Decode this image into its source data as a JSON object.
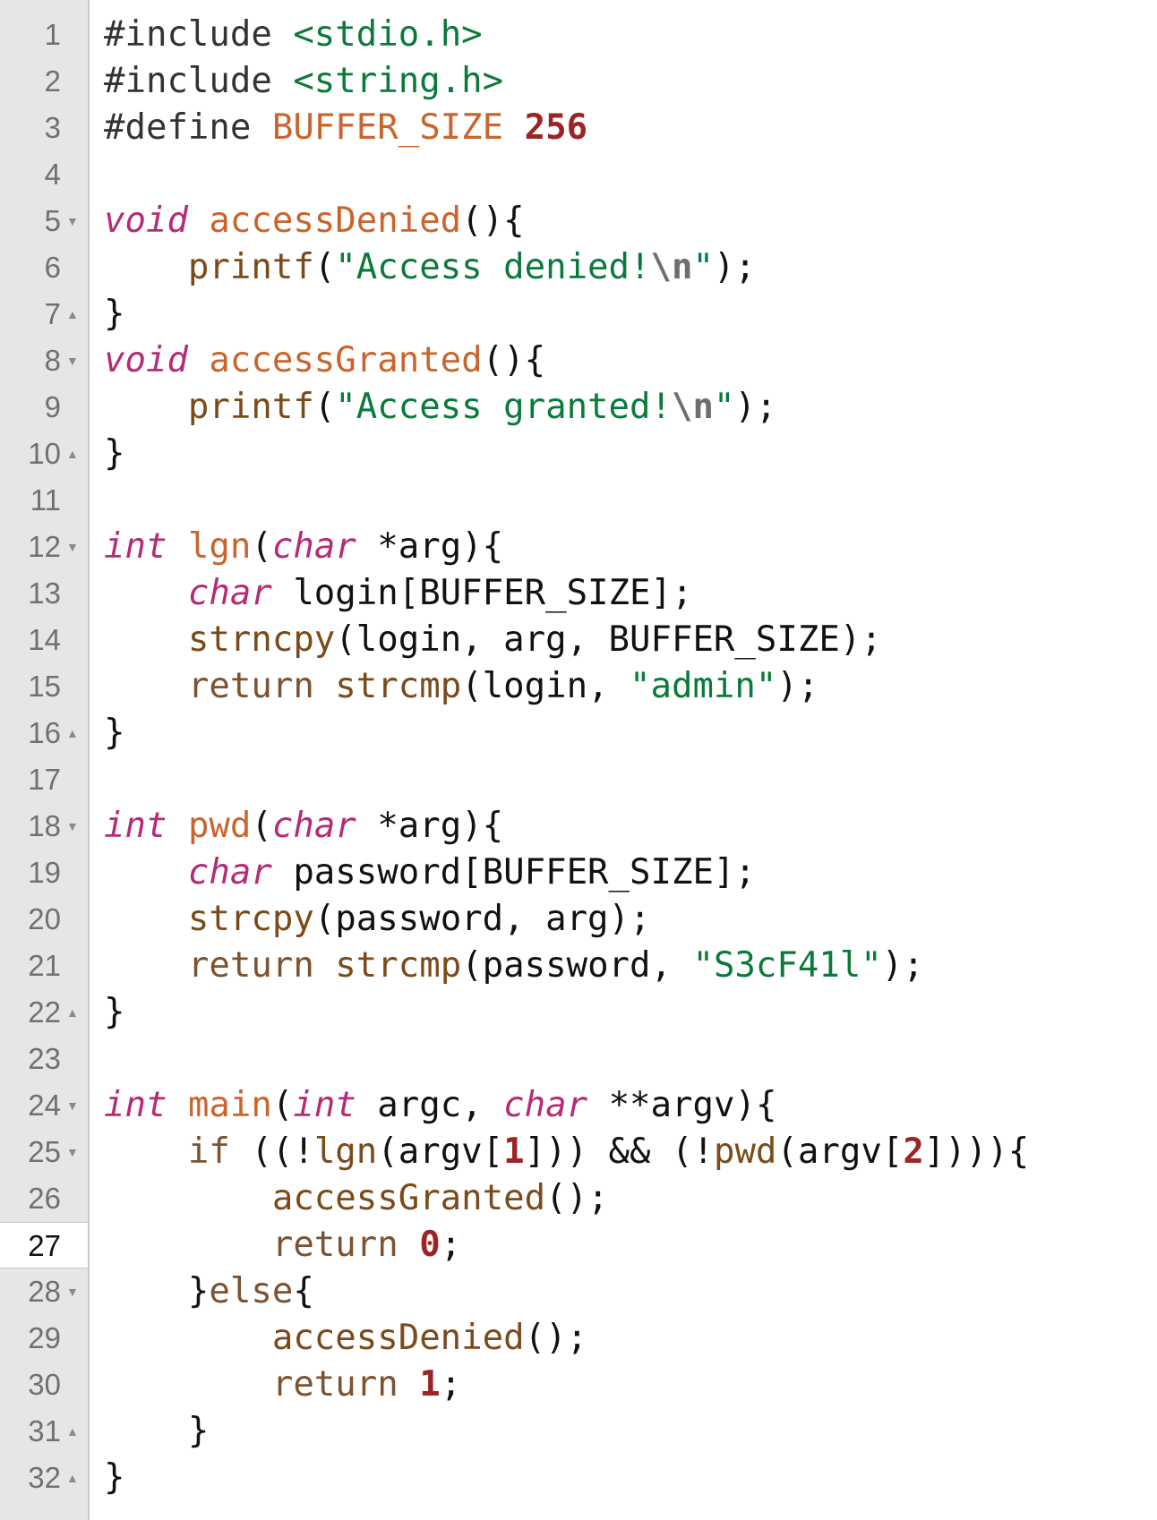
{
  "editor": {
    "active_line": 27,
    "lines": [
      {
        "n": "1",
        "fold": "",
        "tokens": [
          {
            "c": "t-pp",
            "t": "#include "
          },
          {
            "c": "t-str",
            "t": "<stdio.h>"
          }
        ]
      },
      {
        "n": "2",
        "fold": "",
        "tokens": [
          {
            "c": "t-pp",
            "t": "#include "
          },
          {
            "c": "t-str",
            "t": "<string.h>"
          }
        ]
      },
      {
        "n": "3",
        "fold": "",
        "tokens": [
          {
            "c": "t-pp",
            "t": "#define "
          },
          {
            "c": "t-mac",
            "t": "BUFFER_SIZE"
          },
          {
            "c": "t-plain",
            "t": " "
          },
          {
            "c": "t-num",
            "t": "256"
          }
        ]
      },
      {
        "n": "4",
        "fold": "",
        "tokens": []
      },
      {
        "n": "5",
        "fold": "▼",
        "tokens": [
          {
            "c": "t-kw",
            "t": "void"
          },
          {
            "c": "t-plain",
            "t": " "
          },
          {
            "c": "t-func",
            "t": "accessDenied"
          },
          {
            "c": "t-op",
            "t": "(){"
          }
        ]
      },
      {
        "n": "6",
        "fold": "",
        "tokens": [
          {
            "c": "t-plain",
            "t": "    "
          },
          {
            "c": "t-call",
            "t": "printf"
          },
          {
            "c": "t-op",
            "t": "("
          },
          {
            "c": "t-str",
            "t": "\"Access denied!"
          },
          {
            "c": "t-esc",
            "t": "\\n"
          },
          {
            "c": "t-str",
            "t": "\""
          },
          {
            "c": "t-op",
            "t": ");"
          }
        ]
      },
      {
        "n": "7",
        "fold": "▲",
        "tokens": [
          {
            "c": "t-op",
            "t": "}"
          }
        ]
      },
      {
        "n": "8",
        "fold": "▼",
        "tokens": [
          {
            "c": "t-kw",
            "t": "void"
          },
          {
            "c": "t-plain",
            "t": " "
          },
          {
            "c": "t-func",
            "t": "accessGranted"
          },
          {
            "c": "t-op",
            "t": "(){"
          }
        ]
      },
      {
        "n": "9",
        "fold": "",
        "tokens": [
          {
            "c": "t-plain",
            "t": "    "
          },
          {
            "c": "t-call",
            "t": "printf"
          },
          {
            "c": "t-op",
            "t": "("
          },
          {
            "c": "t-str",
            "t": "\"Access granted!"
          },
          {
            "c": "t-esc",
            "t": "\\n"
          },
          {
            "c": "t-str",
            "t": "\""
          },
          {
            "c": "t-op",
            "t": ");"
          }
        ]
      },
      {
        "n": "10",
        "fold": "▲",
        "tokens": [
          {
            "c": "t-op",
            "t": "}"
          }
        ]
      },
      {
        "n": "11",
        "fold": "",
        "tokens": []
      },
      {
        "n": "12",
        "fold": "▼",
        "tokens": [
          {
            "c": "t-kw",
            "t": "int"
          },
          {
            "c": "t-plain",
            "t": " "
          },
          {
            "c": "t-func",
            "t": "lgn"
          },
          {
            "c": "t-op",
            "t": "("
          },
          {
            "c": "t-kw",
            "t": "char"
          },
          {
            "c": "t-plain",
            "t": " *arg"
          },
          {
            "c": "t-op",
            "t": "){"
          }
        ]
      },
      {
        "n": "13",
        "fold": "",
        "tokens": [
          {
            "c": "t-plain",
            "t": "    "
          },
          {
            "c": "t-kw",
            "t": "char"
          },
          {
            "c": "t-plain",
            "t": " login[BUFFER_SIZE];"
          }
        ]
      },
      {
        "n": "14",
        "fold": "",
        "tokens": [
          {
            "c": "t-plain",
            "t": "    "
          },
          {
            "c": "t-call",
            "t": "strncpy"
          },
          {
            "c": "t-plain",
            "t": "(login, arg, BUFFER_SIZE);"
          }
        ]
      },
      {
        "n": "15",
        "fold": "",
        "tokens": [
          {
            "c": "t-plain",
            "t": "    "
          },
          {
            "c": "t-ret",
            "t": "return"
          },
          {
            "c": "t-plain",
            "t": " "
          },
          {
            "c": "t-call",
            "t": "strcmp"
          },
          {
            "c": "t-plain",
            "t": "(login, "
          },
          {
            "c": "t-str",
            "t": "\"admin\""
          },
          {
            "c": "t-op",
            "t": ");"
          }
        ]
      },
      {
        "n": "16",
        "fold": "▲",
        "tokens": [
          {
            "c": "t-op",
            "t": "}"
          }
        ]
      },
      {
        "n": "17",
        "fold": "",
        "tokens": []
      },
      {
        "n": "18",
        "fold": "▼",
        "tokens": [
          {
            "c": "t-kw",
            "t": "int"
          },
          {
            "c": "t-plain",
            "t": " "
          },
          {
            "c": "t-func",
            "t": "pwd"
          },
          {
            "c": "t-op",
            "t": "("
          },
          {
            "c": "t-kw",
            "t": "char"
          },
          {
            "c": "t-plain",
            "t": " *arg"
          },
          {
            "c": "t-op",
            "t": "){"
          }
        ]
      },
      {
        "n": "19",
        "fold": "",
        "tokens": [
          {
            "c": "t-plain",
            "t": "    "
          },
          {
            "c": "t-kw",
            "t": "char"
          },
          {
            "c": "t-plain",
            "t": " password[BUFFER_SIZE];"
          }
        ]
      },
      {
        "n": "20",
        "fold": "",
        "tokens": [
          {
            "c": "t-plain",
            "t": "    "
          },
          {
            "c": "t-call",
            "t": "strcpy"
          },
          {
            "c": "t-plain",
            "t": "(password, arg);"
          }
        ]
      },
      {
        "n": "21",
        "fold": "",
        "tokens": [
          {
            "c": "t-plain",
            "t": "    "
          },
          {
            "c": "t-ret",
            "t": "return"
          },
          {
            "c": "t-plain",
            "t": " "
          },
          {
            "c": "t-call",
            "t": "strcmp"
          },
          {
            "c": "t-plain",
            "t": "(password, "
          },
          {
            "c": "t-str",
            "t": "\"S3cF41l\""
          },
          {
            "c": "t-op",
            "t": ");"
          }
        ]
      },
      {
        "n": "22",
        "fold": "▲",
        "tokens": [
          {
            "c": "t-op",
            "t": "}"
          }
        ]
      },
      {
        "n": "23",
        "fold": "",
        "tokens": []
      },
      {
        "n": "24",
        "fold": "▼",
        "tokens": [
          {
            "c": "t-kw",
            "t": "int"
          },
          {
            "c": "t-plain",
            "t": " "
          },
          {
            "c": "t-func",
            "t": "main"
          },
          {
            "c": "t-op",
            "t": "("
          },
          {
            "c": "t-kw",
            "t": "int"
          },
          {
            "c": "t-plain",
            "t": " argc, "
          },
          {
            "c": "t-kw",
            "t": "char"
          },
          {
            "c": "t-plain",
            "t": " **argv"
          },
          {
            "c": "t-op",
            "t": "){"
          }
        ]
      },
      {
        "n": "25",
        "fold": "▼",
        "tokens": [
          {
            "c": "t-plain",
            "t": "    "
          },
          {
            "c": "t-ret",
            "t": "if"
          },
          {
            "c": "t-plain",
            "t": " ((!"
          },
          {
            "c": "t-call",
            "t": "lgn"
          },
          {
            "c": "t-plain",
            "t": "(argv["
          },
          {
            "c": "t-num",
            "t": "1"
          },
          {
            "c": "t-plain",
            "t": "])) && (!"
          },
          {
            "c": "t-call",
            "t": "pwd"
          },
          {
            "c": "t-plain",
            "t": "(argv["
          },
          {
            "c": "t-num",
            "t": "2"
          },
          {
            "c": "t-plain",
            "t": "]))){"
          }
        ]
      },
      {
        "n": "26",
        "fold": "",
        "tokens": [
          {
            "c": "t-plain",
            "t": "        "
          },
          {
            "c": "t-call",
            "t": "accessGranted"
          },
          {
            "c": "t-op",
            "t": "();"
          }
        ]
      },
      {
        "n": "27",
        "fold": "",
        "tokens": [
          {
            "c": "t-plain",
            "t": "        "
          },
          {
            "c": "t-ret",
            "t": "return"
          },
          {
            "c": "t-plain",
            "t": " "
          },
          {
            "c": "t-num",
            "t": "0"
          },
          {
            "c": "t-op",
            "t": ";"
          }
        ]
      },
      {
        "n": "28",
        "fold": "▼",
        "tokens": [
          {
            "c": "t-plain",
            "t": "    }"
          },
          {
            "c": "t-ret",
            "t": "else"
          },
          {
            "c": "t-op",
            "t": "{"
          }
        ]
      },
      {
        "n": "29",
        "fold": "",
        "tokens": [
          {
            "c": "t-plain",
            "t": "        "
          },
          {
            "c": "t-call",
            "t": "accessDenied"
          },
          {
            "c": "t-op",
            "t": "();"
          }
        ]
      },
      {
        "n": "30",
        "fold": "",
        "tokens": [
          {
            "c": "t-plain",
            "t": "        "
          },
          {
            "c": "t-ret",
            "t": "return"
          },
          {
            "c": "t-plain",
            "t": " "
          },
          {
            "c": "t-num",
            "t": "1"
          },
          {
            "c": "t-op",
            "t": ";"
          }
        ]
      },
      {
        "n": "31",
        "fold": "▲",
        "tokens": [
          {
            "c": "t-plain",
            "t": "    }"
          }
        ]
      },
      {
        "n": "32",
        "fold": "▲",
        "tokens": [
          {
            "c": "t-op",
            "t": "}"
          }
        ]
      }
    ]
  }
}
